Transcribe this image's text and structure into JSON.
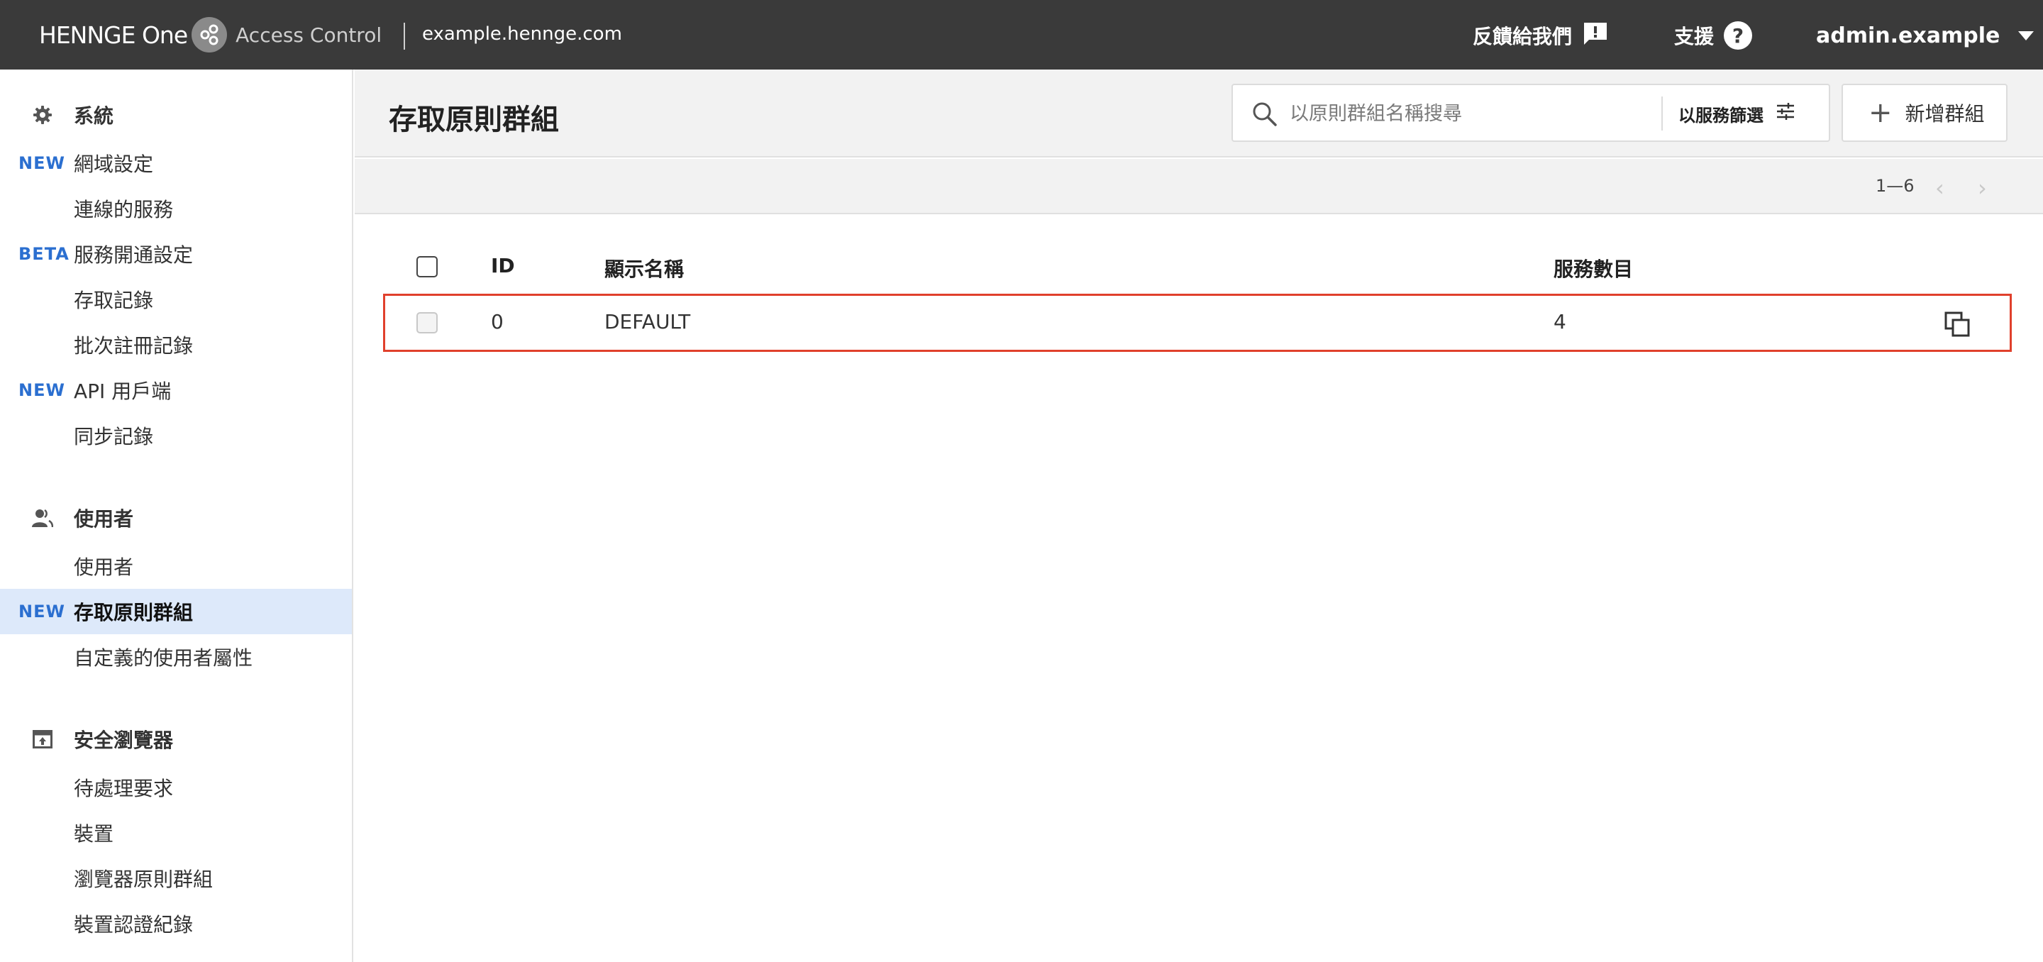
{
  "header": {
    "brand": "HENNGE One",
    "product": "Access Control",
    "tenant": "example.hennge.com",
    "feedback_label": "反饋給我們",
    "support_label": "支援",
    "support_icon": "?",
    "user_label": "admin.example"
  },
  "sidebar": {
    "sections": [
      {
        "title": "系統",
        "icon": "gear-icon",
        "items": [
          {
            "badge": "NEW",
            "label": "網域設定"
          },
          {
            "badge": "",
            "label": "連線的服務"
          },
          {
            "badge": "BETA",
            "label": "服務開通設定"
          },
          {
            "badge": "",
            "label": "存取記錄"
          },
          {
            "badge": "",
            "label": "批次註冊記錄"
          },
          {
            "badge": "NEW",
            "label": "API 用戶端"
          },
          {
            "badge": "",
            "label": "同步記錄"
          }
        ]
      },
      {
        "title": "使用者",
        "icon": "users-icon",
        "items": [
          {
            "badge": "",
            "label": "使用者"
          },
          {
            "badge": "NEW",
            "label": "存取原則群組",
            "active": true
          },
          {
            "badge": "",
            "label": "自定義的使用者屬性"
          }
        ]
      },
      {
        "title": "安全瀏覽器",
        "icon": "browser-icon",
        "items": [
          {
            "badge": "",
            "label": "待處理要求"
          },
          {
            "badge": "",
            "label": "裝置"
          },
          {
            "badge": "",
            "label": "瀏覽器原則群組"
          },
          {
            "badge": "",
            "label": "裝置認證紀錄"
          }
        ]
      }
    ]
  },
  "main": {
    "title": "存取原則群組",
    "search_placeholder": "以原則群組名稱搜尋",
    "filter_label": "以服務篩選",
    "add_label": "新增群組",
    "pagination": {
      "range": "1—6",
      "prev": "‹",
      "next": "›"
    },
    "table": {
      "columns": {
        "id": "ID",
        "name": "顯示名稱",
        "services": "服務數目"
      },
      "rows": [
        {
          "id": "0",
          "name": "DEFAULT",
          "services": "4"
        }
      ]
    }
  },
  "colors": {
    "topbar": "#3a3a3a",
    "accent_badge": "#2b6fd0",
    "active_item": "#dde9fa",
    "highlight_border": "#e0402c"
  }
}
